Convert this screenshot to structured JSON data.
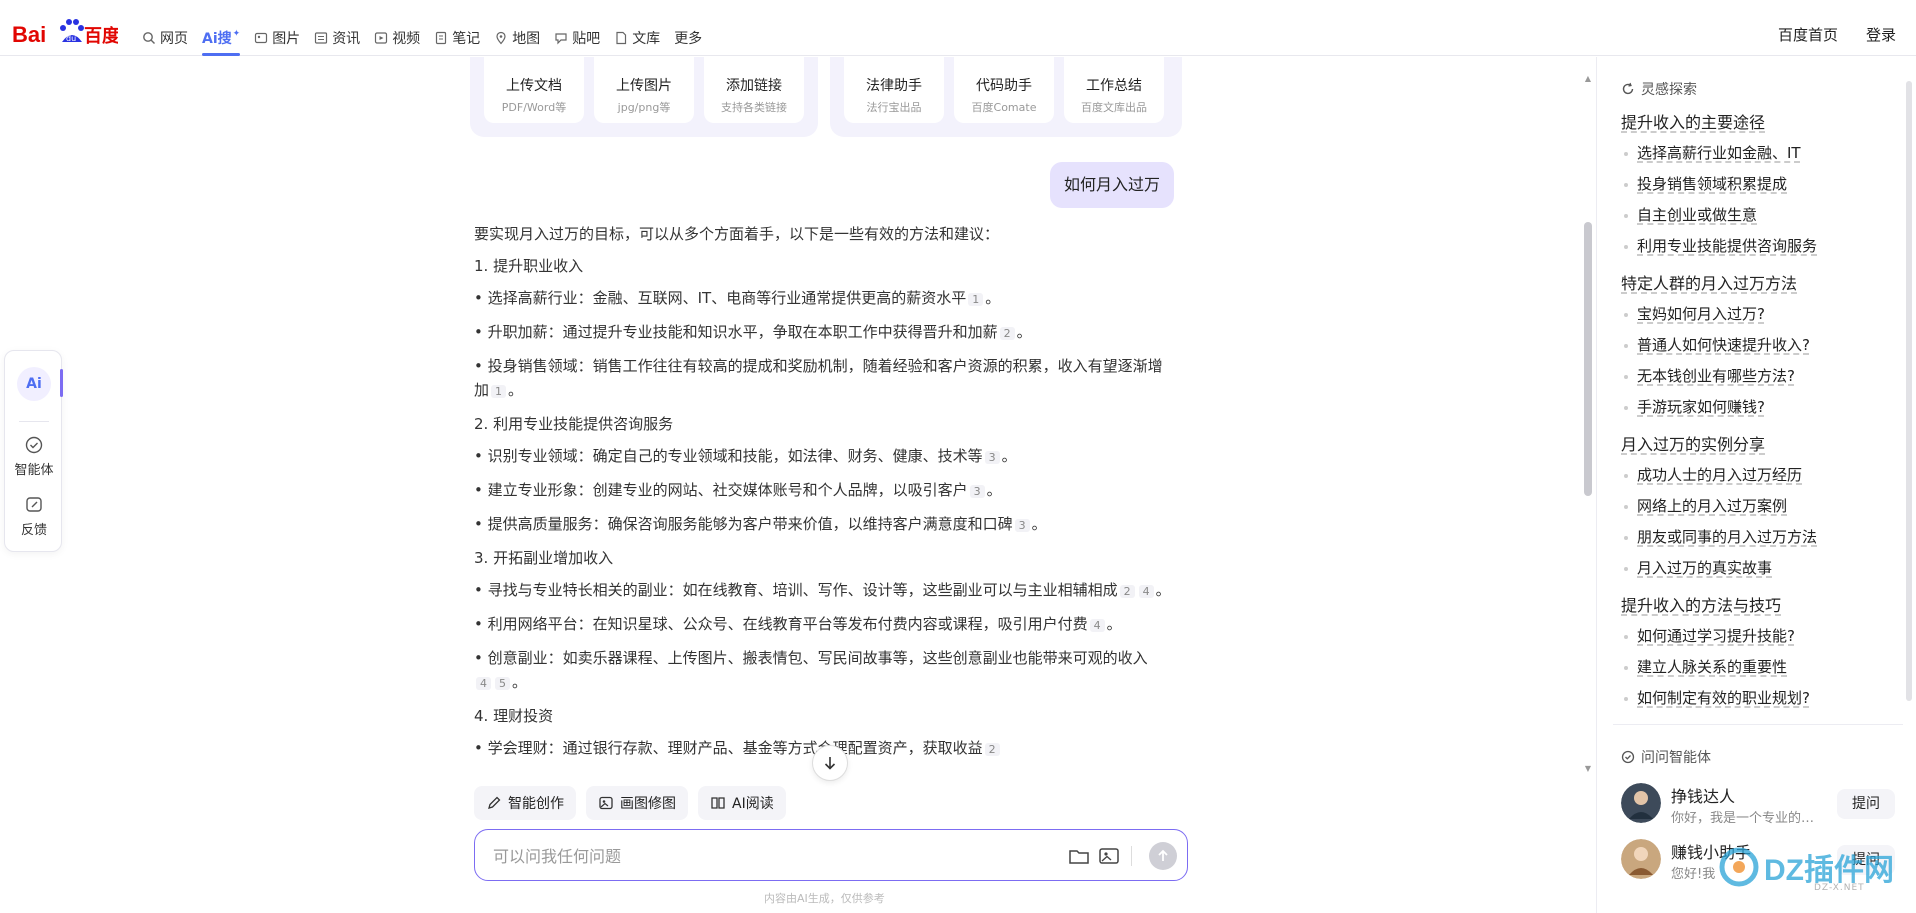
{
  "header": {
    "logo_text": "Bai百度",
    "tabs": [
      {
        "label": "网页",
        "icon": "search-icon",
        "active": false
      },
      {
        "label": "Ai搜",
        "icon": "",
        "active": true
      },
      {
        "label": "图片",
        "icon": "image-icon",
        "active": false
      },
      {
        "label": "资讯",
        "icon": "news-icon",
        "active": false
      },
      {
        "label": "视频",
        "icon": "video-icon",
        "active": false
      },
      {
        "label": "笔记",
        "icon": "note-icon",
        "active": false
      },
      {
        "label": "地图",
        "icon": "map-icon",
        "active": false
      },
      {
        "label": "贴吧",
        "icon": "tieba-icon",
        "active": false
      },
      {
        "label": "文库",
        "icon": "doc-icon",
        "active": false
      },
      {
        "label": "更多",
        "icon": "",
        "active": false
      }
    ],
    "home_link": "百度首页",
    "login_link": "登录"
  },
  "leftbar": {
    "ai_label": "Ai",
    "agent_label": "智能体",
    "feedback_label": "反馈"
  },
  "upload_cards": [
    {
      "title": "上传文档",
      "sub": "PDF/Word等"
    },
    {
      "title": "上传图片",
      "sub": "jpg/png等"
    },
    {
      "title": "添加链接",
      "sub": "支持各类链接"
    },
    {
      "title": "法律助手",
      "sub": "法行宝出品"
    },
    {
      "title": "代码助手",
      "sub": "百度Comate"
    },
    {
      "title": "工作总结",
      "sub": "百度文库出品"
    }
  ],
  "user_query": "如何月入过万",
  "answer": {
    "intro": "要实现月入过万的目标，可以从多个方面着手，以下是一些有效的方法和建议：",
    "s1": "1. 提升职业收入",
    "s1b1": "• 选择高薪行业：金融、互联网、IT、电商等行业通常提供更高的薪资水平",
    "s1b1c": "1",
    "s1b2": "• 升职加薪：通过提升专业技能和知识水平，争取在本职工作中获得晋升和加薪",
    "s1b2c": "2",
    "s1b3": "• 投身销售领域：销售工作往往有较高的提成和奖励机制，随着经验和客户资源的积累，收入有望逐渐增加",
    "s1b3c": "1",
    "s2": "2. 利用专业技能提供咨询服务",
    "s2b1": "• 识别专业领域：确定自己的专业领域和技能，如法律、财务、健康、技术等",
    "s2b1c": "3",
    "s2b2": "• 建立专业形象：创建专业的网站、社交媒体账号和个人品牌，以吸引客户",
    "s2b2c": "3",
    "s2b3": "• 提供高质量服务：确保咨询服务能够为客户带来价值，以维持客户满意度和口碑",
    "s2b3c": "3",
    "s3": "3. 开拓副业增加收入",
    "s3b1": "• 寻找与专业特长相关的副业：如在线教育、培训、写作、设计等，这些副业可以与主业相辅相成",
    "s3b1c1": "2",
    "s3b1c2": "4",
    "s3b2": "• 利用网络平台：在知识星球、公众号、在线教育平台等发布付费内容或课程，吸引用户付费",
    "s3b2c": "4",
    "s3b3": "• 创意副业：如卖乐器课程、上传图片、搬表情包、写民间故事等，这些创意副业也能带来可观的收入",
    "s3b3c1": "4",
    "s3b3c2": "5",
    "s4": "4. 理财投资",
    "s4b1": "• 学会理财：通过银行存款、理财产品、基金等方式合理配置资产，获取收益",
    "s4b1c": "2",
    "period": "。"
  },
  "chips": [
    {
      "label": "智能创作",
      "icon": "pen-icon"
    },
    {
      "label": "画图修图",
      "icon": "image-edit-icon"
    },
    {
      "label": "AI阅读",
      "icon": "book-icon"
    }
  ],
  "input": {
    "placeholder": "可以问我任何问题",
    "value": ""
  },
  "disclaimer": "内容由AI生成，仅供参考",
  "rightpanel": {
    "explore_title": "灵感探索",
    "groups": [
      {
        "head": "提升收入的主要途径",
        "items": [
          "选择高薪行业如金融、IT",
          "投身销售领域积累提成",
          "自主创业或做生意",
          "利用专业技能提供咨询服务"
        ]
      },
      {
        "head": "特定人群的月入过万方法",
        "items": [
          "宝妈如何月入过万?",
          "普通人如何快速提升收入?",
          "无本钱创业有哪些方法?",
          "手游玩家如何赚钱?"
        ]
      },
      {
        "head": "月入过万的实例分享",
        "items": [
          "成功人士的月入过万经历",
          "网络上的月入过万案例",
          "朋友或同事的月入过万方法",
          "月入过万的真实故事"
        ]
      },
      {
        "head": "提升收入的方法与技巧",
        "items": [
          "如何通过学习提升技能?",
          "建立人脉关系的重要性",
          "如何制定有效的职业规划?"
        ]
      }
    ],
    "agents_title": "问问智能体",
    "agents": [
      {
        "name": "挣钱达人",
        "desc": "你好，我是一个专业的…",
        "ask": "提问"
      },
      {
        "name": "赚钱小助手",
        "desc": "您好!我",
        "ask": "提问"
      }
    ]
  },
  "watermark": {
    "text": "DZ插件网",
    "sub": "DZ-X.NET"
  },
  "colors": {
    "accent": "#4e6ef2",
    "purple": "#7c6cf2",
    "bubble": "#e6e2fd",
    "baidu_red": "#e10602",
    "baidu_blue": "#2932e1"
  }
}
